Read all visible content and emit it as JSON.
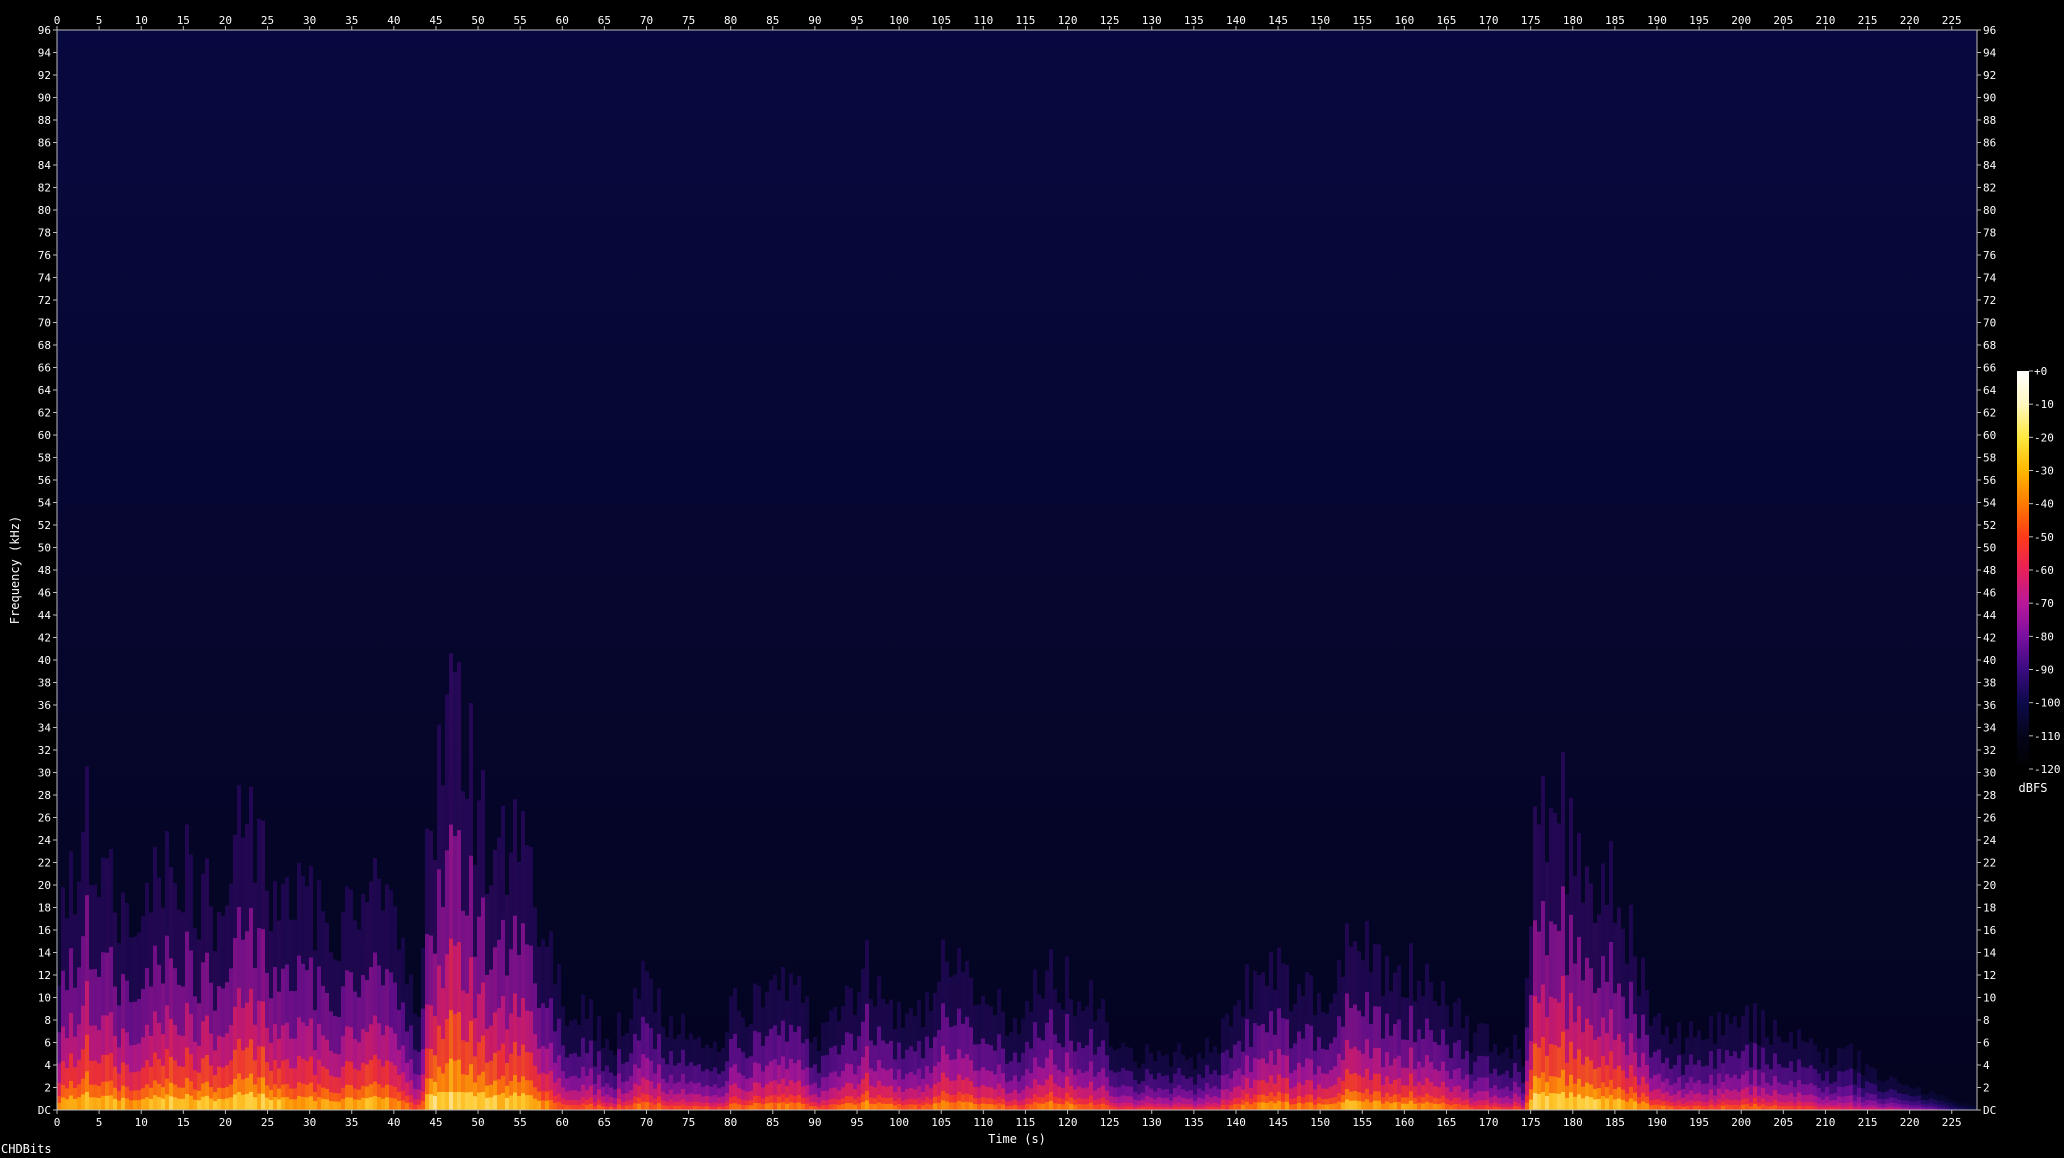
{
  "chart_data": {
    "type": "heatmap",
    "title": "",
    "xlabel": "Time (s)",
    "ylabel": "Frequency (kHz)",
    "x_ticks": [
      0,
      5,
      10,
      15,
      20,
      25,
      30,
      35,
      40,
      45,
      50,
      55,
      60,
      65,
      70,
      75,
      80,
      85,
      90,
      95,
      100,
      105,
      110,
      115,
      120,
      125,
      130,
      135,
      140,
      145,
      150,
      155,
      160,
      165,
      170,
      175,
      180,
      185,
      190,
      195,
      200,
      205,
      210,
      215,
      220,
      225
    ],
    "y_ticks": [
      "DC",
      "2",
      "4",
      "6",
      "8",
      "10",
      "12",
      "14",
      "16",
      "18",
      "20",
      "22",
      "24",
      "26",
      "28",
      "30",
      "32",
      "34",
      "36",
      "38",
      "40",
      "42",
      "44",
      "46",
      "48",
      "50",
      "52",
      "54",
      "56",
      "58",
      "60",
      "62",
      "64",
      "66",
      "68",
      "70",
      "72",
      "74",
      "76",
      "78",
      "80",
      "82",
      "84",
      "86",
      "88",
      "90",
      "92",
      "94",
      "96"
    ],
    "xlim": [
      0,
      228
    ],
    "ylim": [
      0,
      96
    ],
    "colorbar": {
      "label": "dBFS",
      "ticks": [
        "+0",
        "-10",
        "-20",
        "-30",
        "-40",
        "-50",
        "-60",
        "-70",
        "-80",
        "-90",
        "-100",
        "-110",
        "-120"
      ],
      "range": [
        -120,
        0
      ],
      "colors": [
        "#000000",
        "#05051a",
        "#0d0a4a",
        "#3a0b80",
        "#7a10a0",
        "#b8189a",
        "#e8205a",
        "#ff3a1a",
        "#ff7a00",
        "#ffb800",
        "#ffe840",
        "#fff8c0",
        "#ffffff"
      ]
    },
    "activity": {
      "description_times": [
        0,
        3,
        6,
        9,
        12,
        15,
        18,
        21,
        24,
        27,
        30,
        33,
        36,
        39,
        42,
        43,
        44,
        46,
        48,
        50,
        52,
        54,
        56,
        58,
        60,
        63,
        66,
        69,
        72,
        75,
        78,
        81,
        84,
        87,
        90,
        93,
        96,
        99,
        102,
        105,
        108,
        111,
        114,
        117,
        120,
        123,
        126,
        129,
        132,
        135,
        138,
        141,
        144,
        147,
        150,
        153,
        156,
        159,
        162,
        165,
        168,
        171,
        174,
        175,
        176,
        178,
        180,
        183,
        186,
        189,
        192,
        195,
        198,
        201,
        204,
        207,
        210,
        213,
        216,
        219,
        222,
        225,
        228
      ],
      "spread_khz": [
        9,
        16,
        12,
        10,
        14,
        13,
        11,
        15,
        14,
        12,
        11,
        10,
        13,
        11,
        6,
        5,
        16,
        22,
        20,
        16,
        15,
        14,
        13,
        9,
        6,
        5,
        4,
        7,
        5,
        4,
        4,
        6,
        6,
        7,
        4,
        6,
        8,
        6,
        5,
        8,
        7,
        6,
        4,
        8,
        7,
        6,
        3,
        3,
        3,
        3,
        4,
        7,
        8,
        7,
        6,
        10,
        8,
        8,
        7,
        6,
        4,
        4,
        3,
        14,
        18,
        17,
        15,
        13,
        11,
        6,
        4,
        4,
        5,
        5,
        4,
        4,
        3,
        3,
        2,
        1.5,
        1,
        0.5,
        0.2
      ],
      "intensity": [
        0.8,
        0.95,
        0.9,
        0.85,
        0.95,
        0.95,
        0.9,
        0.95,
        0.95,
        0.9,
        0.88,
        0.85,
        0.92,
        0.85,
        0.7,
        0.65,
        1.0,
        1.0,
        1.0,
        0.98,
        0.95,
        0.95,
        0.92,
        0.8,
        0.7,
        0.68,
        0.65,
        0.75,
        0.68,
        0.65,
        0.65,
        0.72,
        0.75,
        0.78,
        0.65,
        0.72,
        0.8,
        0.75,
        0.7,
        0.82,
        0.78,
        0.75,
        0.65,
        0.8,
        0.78,
        0.72,
        0.6,
        0.6,
        0.6,
        0.6,
        0.62,
        0.78,
        0.82,
        0.8,
        0.78,
        0.88,
        0.85,
        0.85,
        0.8,
        0.78,
        0.65,
        0.65,
        0.6,
        0.95,
        1.0,
        1.0,
        0.98,
        0.95,
        0.9,
        0.78,
        0.68,
        0.68,
        0.7,
        0.72,
        0.65,
        0.62,
        0.58,
        0.55,
        0.5,
        0.45,
        0.35,
        0.2,
        0.05
      ]
    }
  },
  "footer": {
    "label": "CHDBits"
  }
}
